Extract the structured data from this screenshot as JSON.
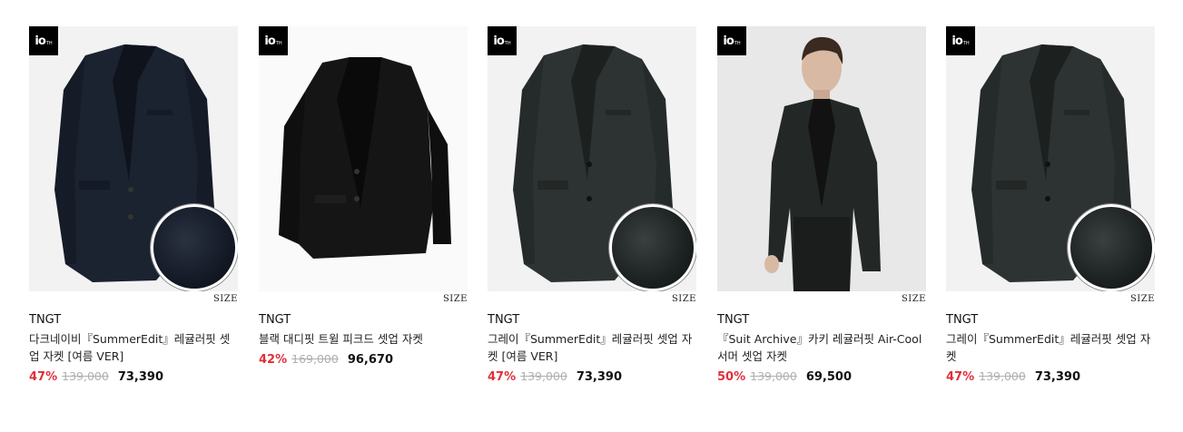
{
  "badge": {
    "main": "io",
    "sub": "TH"
  },
  "size_label": "SIZE",
  "products": [
    {
      "brand": "TNGT",
      "title": "다크네이비『SummerEdit』레귤러핏 셋업 자켓 [여름 VER]",
      "discount": "47%",
      "original_price": "139,000",
      "sale_price": "73,390",
      "jacket_color": "#1b2230",
      "swatch": "navy",
      "image_icon": "jacket-product-image"
    },
    {
      "brand": "TNGT",
      "title": "블랙 대디핏 트윌 피크드 셋업 자켓",
      "discount": "42%",
      "original_price": "169,000",
      "sale_price": "96,670",
      "jacket_color": "#151515",
      "swatch": "none",
      "image_icon": "jacket-product-image"
    },
    {
      "brand": "TNGT",
      "title": "그레이『SummerEdit』레귤러핏 셋업 자켓 [여름 VER]",
      "discount": "47%",
      "original_price": "139,000",
      "sale_price": "73,390",
      "jacket_color": "#2d3332",
      "swatch": "gray",
      "image_icon": "jacket-product-image"
    },
    {
      "brand": "TNGT",
      "title": "『Suit Archive』카키 레귤러핏 Air-Cool 서머 셋업 자켓",
      "discount": "50%",
      "original_price": "139,000",
      "sale_price": "69,500",
      "jacket_color": "#232826",
      "swatch": "none",
      "image_icon": "model-wearing-jacket-image"
    },
    {
      "brand": "TNGT",
      "title": "그레이『SummerEdit』레귤러핏 셋업 자켓",
      "discount": "47%",
      "original_price": "139,000",
      "sale_price": "73,390",
      "jacket_color": "#2d3332",
      "swatch": "gray",
      "image_icon": "jacket-product-image"
    }
  ],
  "colors": {
    "discount": "#e0303a",
    "original_price": "#b0b0b0"
  }
}
